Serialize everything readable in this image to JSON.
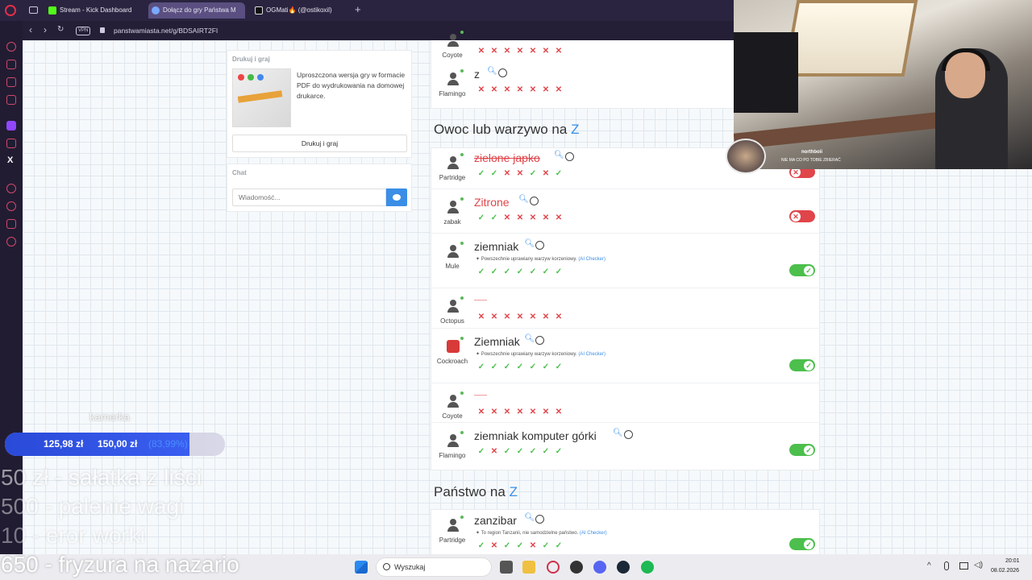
{
  "browser": {
    "tabs": [
      {
        "label": "Stream - Kick Dashboard",
        "color": "#53fc18"
      },
      {
        "label": "Dołącz do gry Państwa M",
        "color": "#7aa7ff"
      },
      {
        "label": "OGMati🔥 (@ostikoxil)",
        "color": "#ffffff"
      }
    ],
    "vpn_label": "VPN",
    "url": "panstwamiasta.net/g/BDSAIRT2FI"
  },
  "left_panel": {
    "print_title": "Drukuj i graj",
    "print_desc": "Uproszczona wersja gry w formacie PDF do wydrukowania na domowej drukarce.",
    "print_button": "Drukuj i graj",
    "chat_title": "Chat",
    "chat_placeholder": "Wiadomość..."
  },
  "prev_rows": [
    {
      "player": "Coyote",
      "answer": "",
      "marks": [
        "x",
        "x",
        "x",
        "x",
        "x",
        "x",
        "x"
      ]
    },
    {
      "player": "Flamingo",
      "answer": "z",
      "marks": [
        "x",
        "x",
        "x",
        "x",
        "x",
        "x",
        "x"
      ]
    }
  ],
  "section1": {
    "title": "Owoc lub warzywo na",
    "letter": "Z",
    "rows": [
      {
        "player": "Partridge",
        "answer": "zielone japko",
        "style": "bad",
        "marks": [
          "v",
          "v",
          "x",
          "x",
          "v",
          "x",
          "v"
        ],
        "toggle": "off"
      },
      {
        "player": "zabak",
        "answer": "Zitrone",
        "style": "bad2",
        "marks": [
          "v",
          "v",
          "x",
          "x",
          "x",
          "x",
          "x"
        ],
        "toggle": "off"
      },
      {
        "player": "Mule",
        "answer": "ziemniak",
        "style": "ok",
        "ai": "Powszechnie uprawiany warzyw korzeniowy.",
        "ai_tag": "(AI Checker)",
        "marks": [
          "v",
          "v",
          "v",
          "v",
          "v",
          "v",
          "v"
        ],
        "toggle": "on"
      },
      {
        "player": "Octopus",
        "answer": "——",
        "style": "empty",
        "marks": [
          "x",
          "x",
          "x",
          "x",
          "x",
          "x",
          "x"
        ],
        "toggle": ""
      },
      {
        "player": "Cockroach",
        "answer": "Ziemniak",
        "style": "ok",
        "ai": "Powszechnie uprawiany warzyw korzeniowy.",
        "ai_tag": "(AI Checker)",
        "marks": [
          "v",
          "v",
          "v",
          "v",
          "v",
          "v",
          "v"
        ],
        "toggle": "on"
      },
      {
        "player": "Coyote",
        "answer": "——",
        "style": "empty",
        "marks": [
          "x",
          "x",
          "x",
          "x",
          "x",
          "x",
          "x"
        ],
        "toggle": ""
      },
      {
        "player": "Flamingo",
        "answer": "ziemniak komputer górki",
        "style": "ok",
        "marks": [
          "v",
          "x",
          "v",
          "v",
          "v",
          "v",
          "v"
        ],
        "toggle": "on"
      }
    ]
  },
  "section2": {
    "title": "Państwo na",
    "letter": "Z",
    "rows": [
      {
        "player": "Partridge",
        "answer": "zanzibar",
        "style": "ok",
        "ai": "To region Tanzanii, nie samodzielne państwo.",
        "ai_tag": "(AI Checker)",
        "marks": [
          "v",
          "x",
          "v",
          "v",
          "x",
          "v",
          "v"
        ],
        "toggle": "on"
      }
    ]
  },
  "webcam_chat": {
    "user": "northboii",
    "message": "NIE MA CO PO TOBIE ZBIERAĆ"
  },
  "overlay": {
    "kamerka": "kamerka",
    "goal_current": "125,98 zł",
    "goal_target": "150,00 zł",
    "goal_pct": "(83,99%)",
    "goal_fraction": 0.84,
    "lines": [
      "50 zł - sałatka z liści",
      "500 - palenie wagi",
      "10 - eror worki",
      "650 - fryzura na nazario"
    ]
  },
  "taskbar": {
    "search": "Wyszukaj",
    "time": "20:01",
    "date": "08.02.2026"
  }
}
